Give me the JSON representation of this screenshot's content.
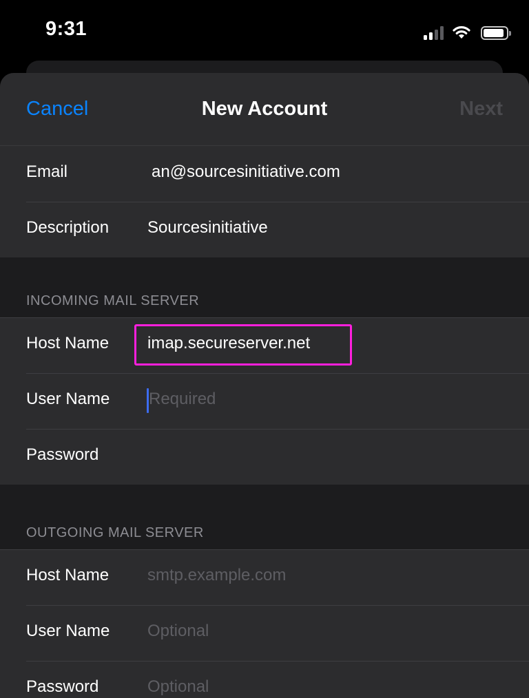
{
  "status_bar": {
    "time": "9:31",
    "signal_icon": "cellular-signal-icon",
    "wifi_icon": "wifi-icon",
    "battery_icon": "battery-icon",
    "battery_level_percent": 90
  },
  "navbar": {
    "cancel_label": "Cancel",
    "title": "New Account",
    "next_label": "Next",
    "accent_color": "#0a84ff"
  },
  "account": {
    "email_label": "Email",
    "email_value": "an@sourcesinitiative.com",
    "description_label": "Description",
    "description_value": "Sourcesinitiative"
  },
  "incoming": {
    "header": "INCOMING MAIL SERVER",
    "host_label": "Host Name",
    "host_value": "imap.secureserver.net",
    "user_label": "User Name",
    "user_placeholder": "Required",
    "password_label": "Password",
    "highlight_color": "#ff1fdd"
  },
  "outgoing": {
    "header": "OUTGOING MAIL SERVER",
    "host_label": "Host Name",
    "host_placeholder": "smtp.example.com",
    "user_label": "User Name",
    "user_placeholder": "Optional",
    "password_label": "Password",
    "password_placeholder": "Optional"
  }
}
